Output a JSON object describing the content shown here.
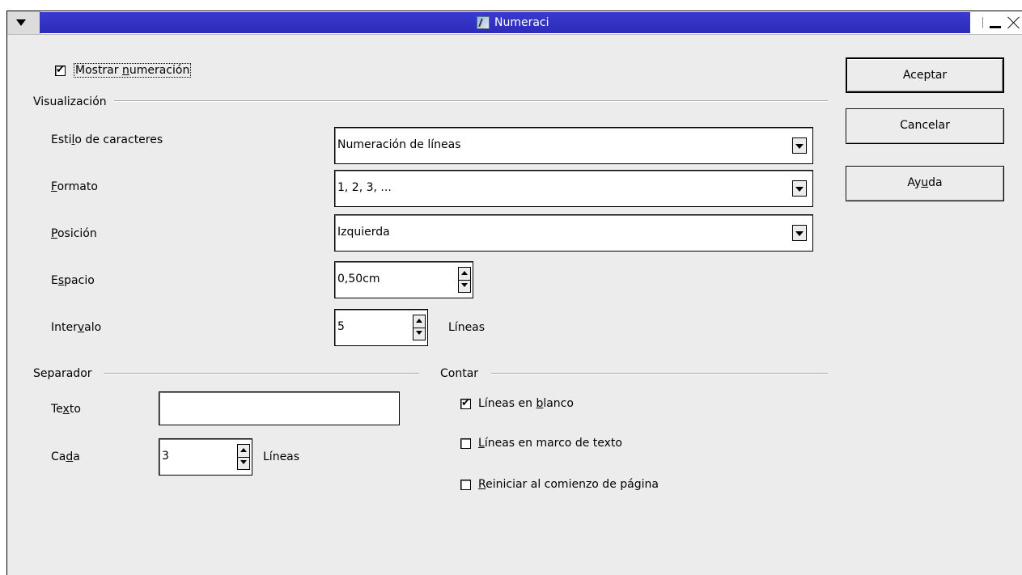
{
  "window": {
    "title": "Numeraci"
  },
  "show_numbering": {
    "label_before": "Mostrar ",
    "label_accel": "n",
    "label_after": "umeración",
    "checked": true
  },
  "visualizacion": {
    "heading": "Visualización",
    "char_style": {
      "label_before": "Esti",
      "label_accel": "l",
      "label_after": "o de caracteres",
      "value": "Numeración de líneas"
    },
    "format": {
      "label_before": "",
      "label_accel": "F",
      "label_after": "ormato",
      "value": "1, 2, 3, ..."
    },
    "position": {
      "label_before": "",
      "label_accel": "P",
      "label_after": "osición",
      "value": "Izquierda"
    },
    "spacing": {
      "label_before": "E",
      "label_accel": "s",
      "label_after": "pacio",
      "value": "0,50cm"
    },
    "interval": {
      "label_before": "Inter",
      "label_accel": "v",
      "label_after": "alo",
      "value": "5",
      "unit": "Líneas"
    }
  },
  "separador": {
    "heading": "Separador",
    "text": {
      "label_before": "Te",
      "label_accel": "x",
      "label_after": "to",
      "value": ""
    },
    "every": {
      "label_before": "Ca",
      "label_accel": "d",
      "label_after": "a",
      "value": "3",
      "unit": "Líneas"
    }
  },
  "contar": {
    "heading": "Contar",
    "blank_lines": {
      "label_before": "Líneas en ",
      "label_accel": "b",
      "label_after": "lanco",
      "checked": true
    },
    "text_frames": {
      "label_before": "",
      "label_accel": "L",
      "label_after": "íneas en marco de texto",
      "checked": false
    },
    "restart_page": {
      "label_before": "",
      "label_accel": "R",
      "label_after": "einiciar al comienzo de página",
      "checked": false
    }
  },
  "buttons": {
    "ok": "Aceptar",
    "cancel": "Cancelar",
    "help_before": "Ay",
    "help_accel": "u",
    "help_after": "da"
  }
}
